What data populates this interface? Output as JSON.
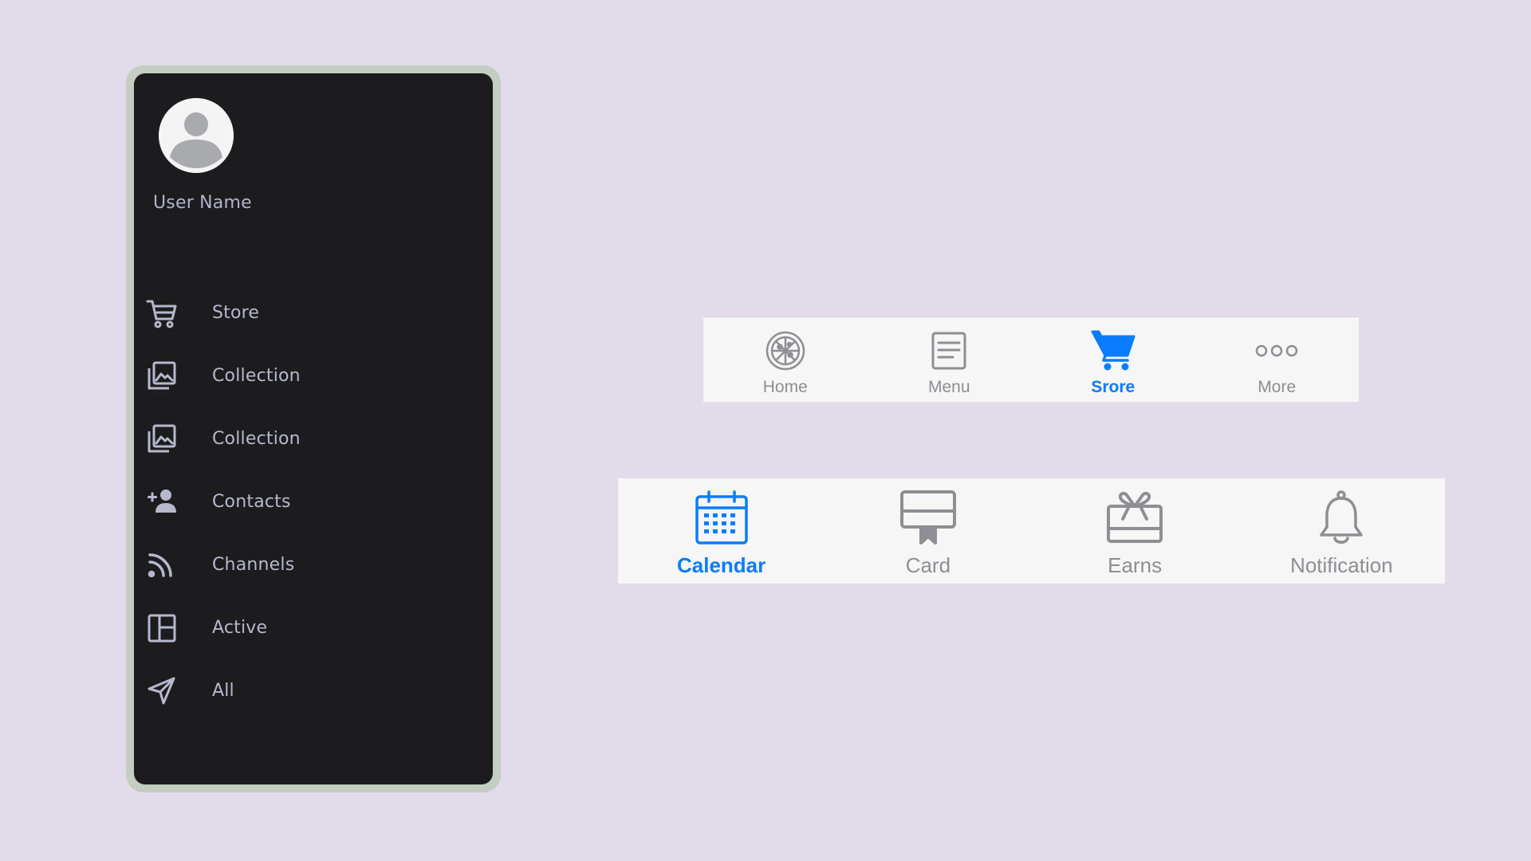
{
  "colors": {
    "background": "#e2dbea",
    "drawer_bg": "#1c1c1f",
    "drawer_frame": "#c3cdc2",
    "drawer_text": "#b6b9cb",
    "tab_bg": "#f6f6f7",
    "tab_inactive": "#8e8e93",
    "tab_active": "#0a7cff"
  },
  "drawer": {
    "avatar_icon": "user-avatar-icon",
    "user_name": "User Name",
    "items": [
      {
        "label": "Store",
        "icon": "cart-icon"
      },
      {
        "label": "Collection",
        "icon": "collection-icon"
      },
      {
        "label": "Collection",
        "icon": "collection-icon"
      },
      {
        "label": "Contacts",
        "icon": "add-contact-icon"
      },
      {
        "label": "Channels",
        "icon": "rss-icon"
      },
      {
        "label": "Active",
        "icon": "layout-icon"
      },
      {
        "label": "All",
        "icon": "send-icon"
      }
    ]
  },
  "tabbar_top": {
    "active_index": 2,
    "tabs": [
      {
        "label": "Home",
        "icon": "pizza-icon"
      },
      {
        "label": "Menu",
        "icon": "menu-list-icon"
      },
      {
        "label": "Srore",
        "icon": "cart-icon"
      },
      {
        "label": "More",
        "icon": "more-dots-icon"
      }
    ]
  },
  "tabbar_bottom": {
    "active_index": 0,
    "tabs": [
      {
        "label": "Calendar",
        "icon": "calendar-icon"
      },
      {
        "label": "Card",
        "icon": "card-icon"
      },
      {
        "label": "Earns",
        "icon": "gift-icon"
      },
      {
        "label": "Notification",
        "icon": "bell-icon"
      }
    ]
  }
}
